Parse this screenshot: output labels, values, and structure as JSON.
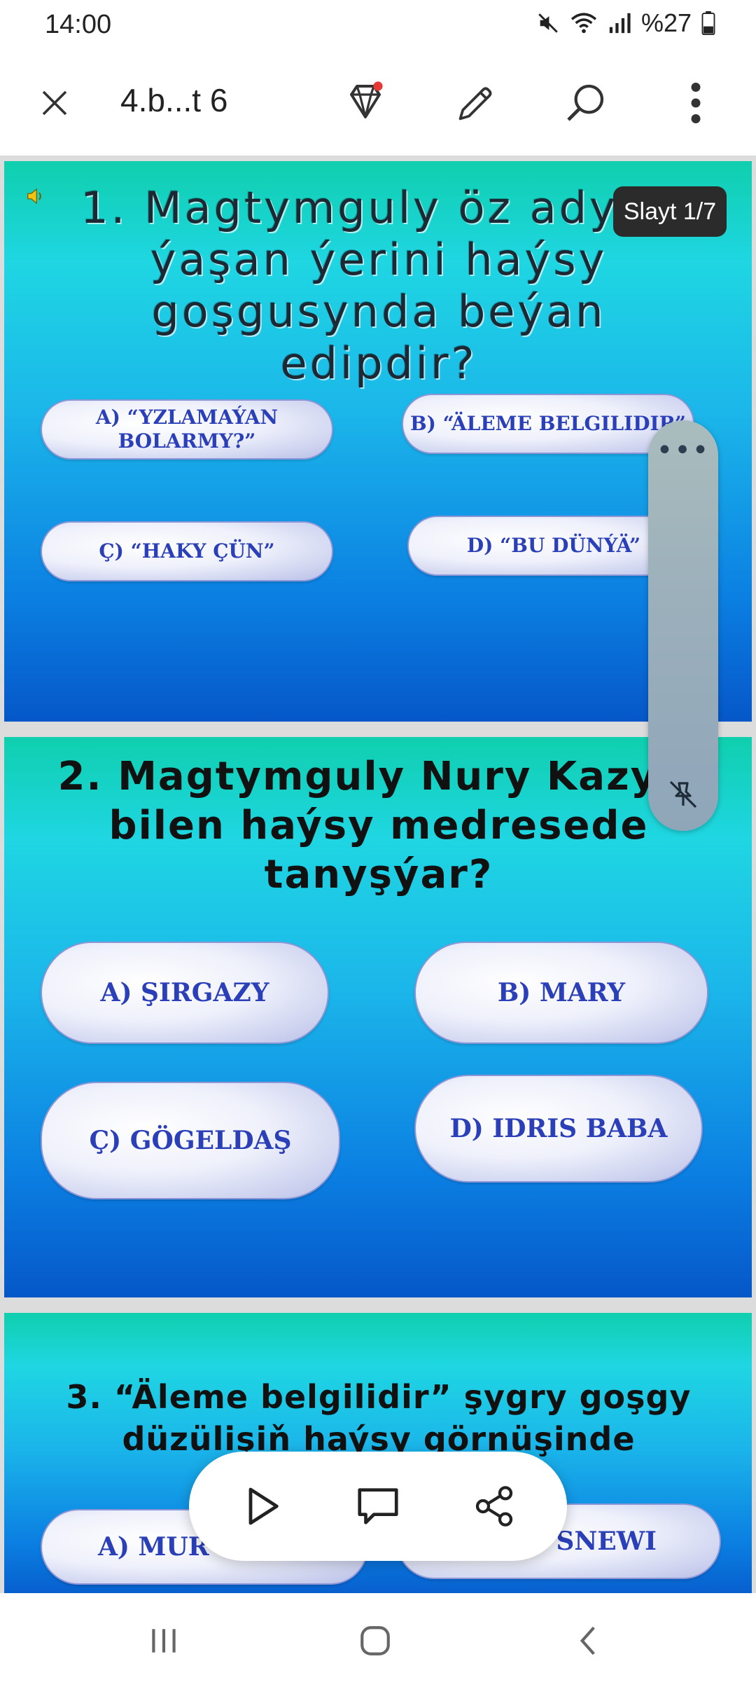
{
  "status": {
    "time": "14:00",
    "battery": "%27"
  },
  "toolbar": {
    "doc_title": "4.b...t 6",
    "icons": [
      "close-icon",
      "premium-diamond-icon",
      "edit-pencil-icon",
      "search-icon",
      "more-vertical-icon"
    ]
  },
  "slide_badge": "Slayt 1/7",
  "slides": [
    {
      "question": "1. Magtymguly öz adyny ýaşan ýerini haýsy goşgusynda beýan edipdir?",
      "options": [
        "A) “YZLAMAÝAN BOLARMY?”",
        "B) “ÄLEME BELGILIDIR”",
        "Ç) “HAKY ÇÜN”",
        "D) “BU DÜNÝÄ”"
      ]
    },
    {
      "question": "2. Magtymguly Nury Kazym bilen haýsy medresede tanyşýar?",
      "options": [
        "A) ŞIRGAZY",
        "B) MARY",
        "Ç) GÖGELDAŞ",
        "D) IDRIS BABA"
      ]
    },
    {
      "question": "3. “Äleme belgilidir” şygry goşgy düzülişiň haýsy görnüşinde ýazylypdyr?",
      "options": [
        "A) MUR",
        "SNEWI"
      ]
    }
  ],
  "colors": {
    "slide_top": "#0fcfae",
    "slide_bottom": "#0657c8",
    "option_text": "#2a3fb8",
    "badge_bg": "#2b2b2b"
  },
  "floating_toolbar": {
    "icons": [
      "play-icon",
      "comment-icon",
      "share-icon"
    ]
  },
  "nav": {
    "icons": [
      "recent-apps-icon",
      "home-icon",
      "back-icon"
    ]
  }
}
